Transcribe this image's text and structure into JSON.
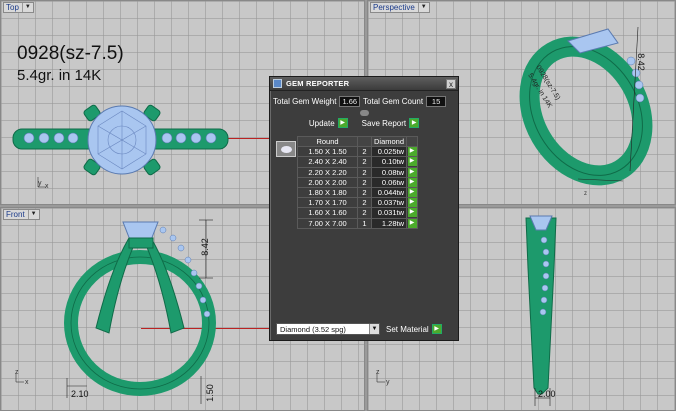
{
  "viewports": {
    "top": {
      "label": "Top"
    },
    "perspective": {
      "label": "Perspective"
    },
    "front": {
      "label": "Front"
    },
    "right": {
      "label": ""
    }
  },
  "annotations": {
    "line1": "0928(sz-7.5)",
    "line2": "5.4gr.  in 14K"
  },
  "dimensions": {
    "front_height": "8.42",
    "front_bottom_left": "2.10",
    "front_bottom_right": "1.50",
    "persp_height": "8.42",
    "right_bottom": "2.00"
  },
  "gem_reporter": {
    "title": "GEM REPORTER",
    "close_label": "x",
    "total_weight_label": "Total Gem Weight",
    "total_weight_value": "1.66",
    "total_count_label": "Total Gem Count",
    "total_count_value": "15",
    "update_label": "Update",
    "save_report_label": "Save Report",
    "table_headers": {
      "shape": "Round",
      "material": "Diamond"
    },
    "rows": [
      {
        "size": "1.50 X 1.50",
        "qty": "2",
        "weight": "0.025tw"
      },
      {
        "size": "2.40 X 2.40",
        "qty": "2",
        "weight": "0.10tw"
      },
      {
        "size": "2.20 X 2.20",
        "qty": "2",
        "weight": "0.08tw"
      },
      {
        "size": "2.00 X 2.00",
        "qty": "2",
        "weight": "0.06tw"
      },
      {
        "size": "1.80 X 1.80",
        "qty": "2",
        "weight": "0.044tw"
      },
      {
        "size": "1.70 X 1.70",
        "qty": "2",
        "weight": "0.037tw"
      },
      {
        "size": "1.60 X 1.60",
        "qty": "2",
        "weight": "0.031tw"
      },
      {
        "size": "7.00 X 7.00",
        "qty": "1",
        "weight": "1.28tw"
      }
    ],
    "material_value": "Diamond    (3.52 spg)",
    "set_material_label": "Set Material"
  },
  "colors": {
    "metal": "#1d9a6c",
    "metal_dark": "#0f6b48",
    "gem": "#a9c6f0",
    "go_button": "#4caa2c"
  }
}
